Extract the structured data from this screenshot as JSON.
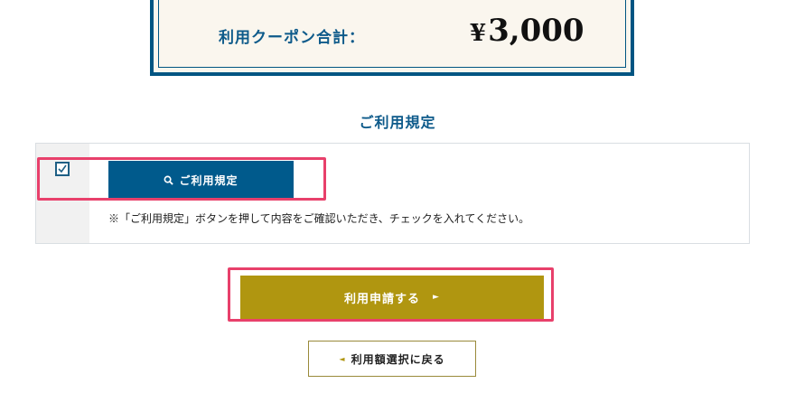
{
  "coupon_summary": {
    "label": "利用クーポン合計：",
    "currency": "¥",
    "amount": "3,000"
  },
  "terms_section": {
    "title": "ご利用規定",
    "checkbox_checked": true,
    "button_label": "ご利用規定",
    "button_icon": "search-icon",
    "note": "※「ご利用規定」ボタンを押して内容をご確認いただき、チェックを入れてください。"
  },
  "actions": {
    "submit_label": "利用申請する",
    "submit_arrow": "►",
    "back_label": "利用額選択に戻る",
    "back_arrow": "◄"
  },
  "colors": {
    "primary_blue": "#005a8c",
    "gold": "#b09610",
    "highlight": "#e8406b",
    "coupon_bg": "#faf6ee"
  }
}
